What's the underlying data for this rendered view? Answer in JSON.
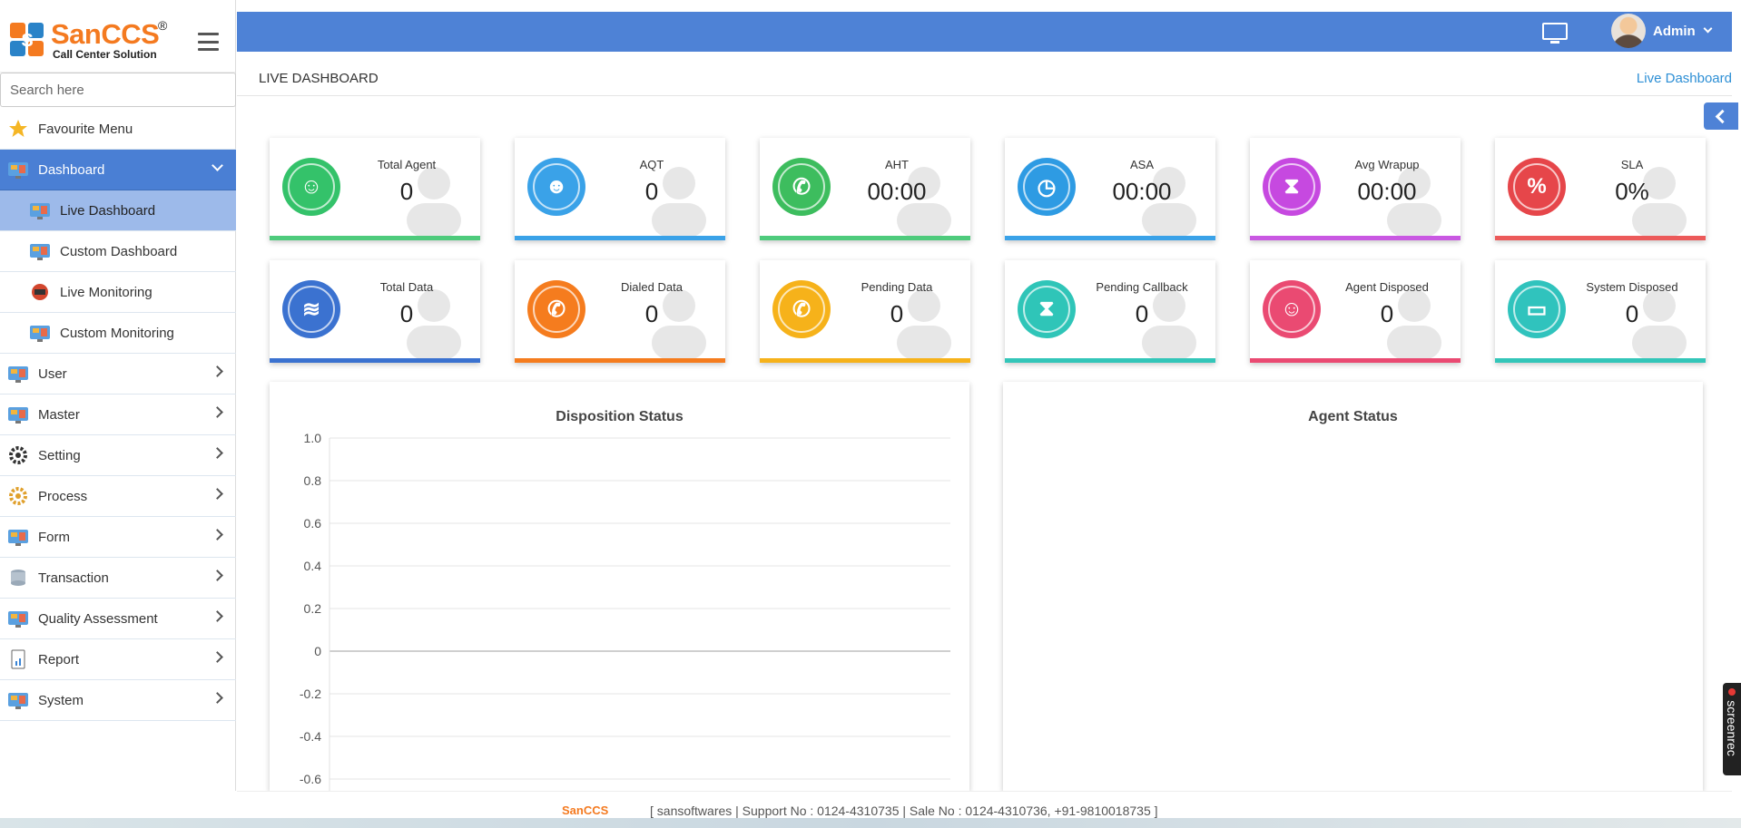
{
  "brand": {
    "name": "SanCCS",
    "reg": "®",
    "tagline": "Call Center Solution"
  },
  "search": {
    "placeholder": "Search here"
  },
  "sidebar": {
    "items": [
      {
        "label": "Favourite Menu",
        "icon": "star-icon"
      },
      {
        "label": "Dashboard",
        "icon": "dashboard-icon",
        "expanded": true
      },
      {
        "label": "Live Dashboard",
        "icon": "live-dashboard-icon",
        "sub": true,
        "current": true
      },
      {
        "label": "Custom Dashboard",
        "icon": "custom-dashboard-icon",
        "sub": true
      },
      {
        "label": "Live Monitoring",
        "icon": "live-monitoring-icon",
        "sub": true
      },
      {
        "label": "Custom Monitoring",
        "icon": "custom-monitoring-icon",
        "sub": true
      },
      {
        "label": "User",
        "icon": "user-icon"
      },
      {
        "label": "Master",
        "icon": "master-icon"
      },
      {
        "label": "Setting",
        "icon": "setting-icon"
      },
      {
        "label": "Process",
        "icon": "process-icon"
      },
      {
        "label": "Form",
        "icon": "form-icon"
      },
      {
        "label": "Transaction",
        "icon": "transaction-icon"
      },
      {
        "label": "Quality Assessment",
        "icon": "quality-assessment-icon"
      },
      {
        "label": "Report",
        "icon": "report-icon"
      },
      {
        "label": "System",
        "icon": "system-icon"
      }
    ]
  },
  "topbar": {
    "user": "Admin"
  },
  "page": {
    "title": "LIVE DASHBOARD",
    "breadcrumb": "Live Dashboard"
  },
  "cards": [
    {
      "label": "Total Agent",
      "value": "0",
      "color": "#34c26a",
      "bar": "#4ecb7c",
      "icon": "agent-icon",
      "glyph": "☺"
    },
    {
      "label": "AQT",
      "value": "0",
      "color": "#3aa2e8",
      "bar": "#3aa2e8",
      "icon": "group-icon",
      "glyph": "☻"
    },
    {
      "label": "AHT",
      "value": "00:00",
      "color": "#3dbd5e",
      "bar": "#4ecb7c",
      "icon": "phone-clock-icon",
      "glyph": "✆"
    },
    {
      "label": "ASA",
      "value": "00:00",
      "color": "#2e9be3",
      "bar": "#3aa2e8",
      "icon": "stopwatch-icon",
      "glyph": "◷"
    },
    {
      "label": "Avg Wrapup",
      "value": "00:00",
      "color": "#c649e0",
      "bar": "#c958e2",
      "icon": "hourglass-icon",
      "glyph": "⧗"
    },
    {
      "label": "SLA",
      "value": "0%",
      "color": "#e6464a",
      "bar": "#ec5a5a",
      "icon": "percent-icon",
      "glyph": "%"
    },
    {
      "label": "Total Data",
      "value": "0",
      "color": "#3b72d0",
      "bar": "#3b72d0",
      "icon": "layers-icon",
      "glyph": "≋"
    },
    {
      "label": "Dialed Data",
      "value": "0",
      "color": "#f57c1e",
      "bar": "#f57c1e",
      "icon": "dialed-phone-icon",
      "glyph": "✆"
    },
    {
      "label": "Pending Data",
      "value": "0",
      "color": "#f6b21a",
      "bar": "#f6b21a",
      "icon": "pending-phone-icon",
      "glyph": "✆"
    },
    {
      "label": "Pending Callback",
      "value": "0",
      "color": "#2fc5b8",
      "bar": "#33c6b9",
      "icon": "callback-hourglass-icon",
      "glyph": "⧗"
    },
    {
      "label": "Agent Disposed",
      "value": "0",
      "color": "#ea4a72",
      "bar": "#ea4a72",
      "icon": "agent-disposed-icon",
      "glyph": "☺"
    },
    {
      "label": "System Disposed",
      "value": "0",
      "color": "#30c3bd",
      "bar": "#33c6b9",
      "icon": "monitor-icon",
      "glyph": "▭"
    }
  ],
  "panels": {
    "disposition_title": "Disposition Status",
    "agent_title": "Agent Status"
  },
  "chart_data": {
    "type": "line",
    "title": "Disposition Status",
    "xlabel": "",
    "ylabel": "",
    "ylim": [
      -0.6,
      1.0
    ],
    "yticks": [
      "1.0",
      "0.8",
      "0.6",
      "0.4",
      "0.2",
      "0",
      "-0.2",
      "-0.4",
      "-0.6"
    ],
    "series": [],
    "grid": true
  },
  "footer": {
    "logo": "SanCCS",
    "text": "[ sansoftwares | Support No : 0124-4310735 | Sale No : 0124-4310736, +91-9810018735 ]"
  },
  "recorder": {
    "label": "screenrec"
  }
}
